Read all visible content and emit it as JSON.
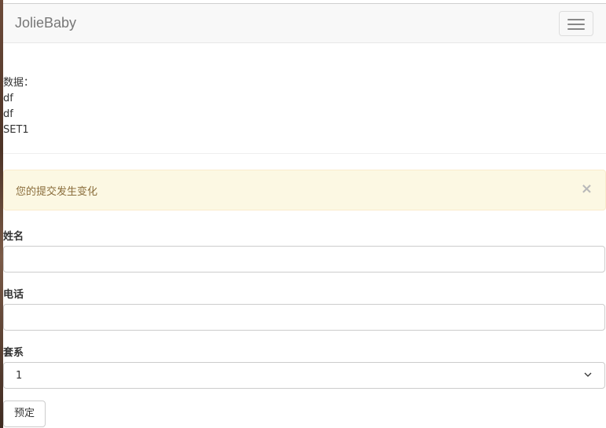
{
  "navbar": {
    "brand": "JolieBaby",
    "toggle_icon": "hamburger-menu-icon"
  },
  "data_section": {
    "heading": "数据：",
    "lines": [
      "df",
      "df",
      "SET1"
    ]
  },
  "alert": {
    "message": "您的提交发生变化",
    "close_symbol": "×",
    "bg_color": "#fcf8e3",
    "text_color": "#8a6d3b"
  },
  "form": {
    "name_label": "姓名",
    "name_value": "",
    "phone_label": "电话",
    "phone_value": "",
    "package_label": "套系",
    "package_selected": "1",
    "submit_label": "预定"
  }
}
